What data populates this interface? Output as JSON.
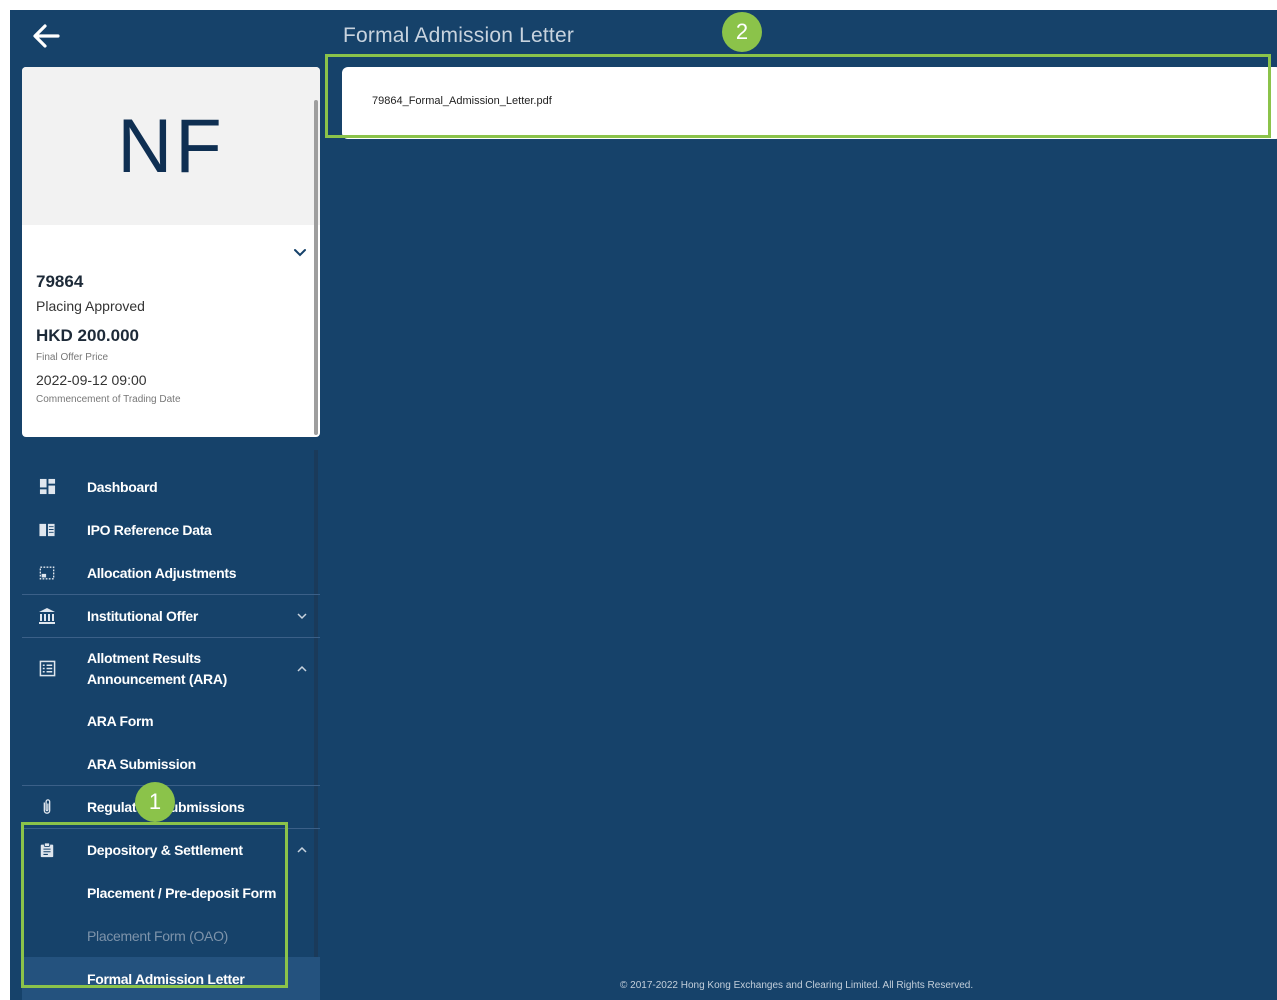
{
  "header": {
    "back_icon": "arrow-left-icon",
    "title": "Formal Admission Letter"
  },
  "profile": {
    "initials": "NF",
    "stock_code": "79864",
    "status": "Placing Approved",
    "price": "HKD 200.000",
    "price_label": "Final Offer Price",
    "trading_date": "2022-09-12 09:00",
    "trading_date_label": "Commencement of Trading Date"
  },
  "nav": {
    "dashboard": "Dashboard",
    "ipo_reference_data": "IPO Reference Data",
    "allocation_adjustments": "Allocation Adjustments",
    "institutional_offer": "Institutional Offer",
    "ara_line1": "Allotment Results",
    "ara_line2": "Announcement (ARA)",
    "ara_form": "ARA Form",
    "ara_submission": "ARA Submission",
    "regulatory_submissions": "Regulatory Submissions",
    "depository_settlement": "Depository & Settlement",
    "placement_predeposit": "Placement / Pre-deposit Form",
    "placement_oao": "Placement Form (OAO)",
    "formal_admission_letter": "Formal Admission Letter"
  },
  "content": {
    "file_name": "79864_Formal_Admission_Letter.pdf"
  },
  "footer": {
    "copyright": "© 2017-2022 Hong Kong Exchanges and Clearing Limited. All Rights Reserved."
  },
  "annotations": {
    "badge_1": "1",
    "badge_2": "2",
    "color": "#8bc34a"
  },
  "colors": {
    "background": "#16426a",
    "card": "#ffffff",
    "active_item": "#24527e"
  }
}
